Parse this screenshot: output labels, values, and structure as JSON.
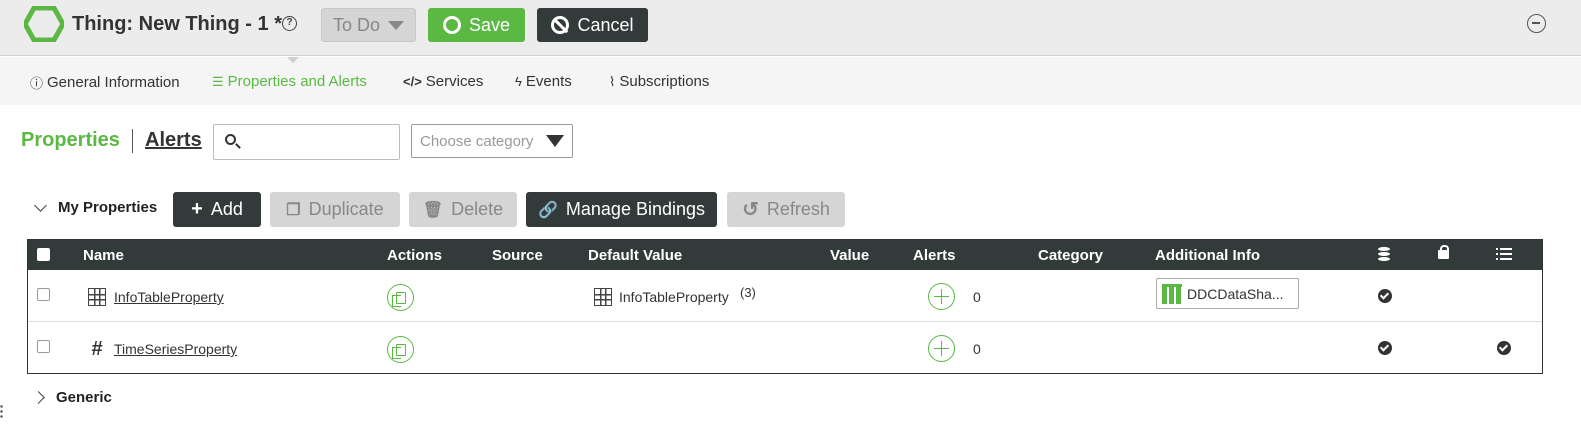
{
  "header": {
    "title": "Thing: New Thing - 1 *",
    "help_icon": "?",
    "status_select": "To Do",
    "save_label": "Save",
    "cancel_label": "Cancel",
    "brand_color": "#5bb943"
  },
  "tabs": [
    {
      "label": "General Information",
      "icon": "info-icon"
    },
    {
      "label": "Properties and Alerts",
      "icon": "list-icon",
      "active": true
    },
    {
      "label": "Services",
      "icon": "code-icon"
    },
    {
      "label": "Events",
      "icon": "bolt-icon"
    },
    {
      "label": "Subscriptions",
      "icon": "rss-icon"
    }
  ],
  "subtabs": {
    "properties": "Properties",
    "alerts": "Alerts"
  },
  "search": {
    "value": "",
    "placeholder": ""
  },
  "category_select": {
    "placeholder": "Choose category"
  },
  "group": {
    "label": "My Properties",
    "add": "Add",
    "duplicate": "Duplicate",
    "delete": "Delete",
    "manage_bindings": "Manage Bindings",
    "refresh": "Refresh"
  },
  "table": {
    "columns": [
      "Name",
      "Actions",
      "Source",
      "Default Value",
      "Value",
      "Alerts",
      "Category",
      "Additional Info"
    ],
    "rows": [
      {
        "type_icon": "infotable-icon",
        "name": "InfoTableProperty",
        "source": "",
        "default_value": "InfoTableProperty",
        "default_count": "(3)",
        "value": "",
        "alerts": "0",
        "category": "",
        "additional_info": "DDCDataSha...",
        "persistent": true,
        "read_only": false,
        "logged": false
      },
      {
        "type_icon": "hash-icon",
        "name": "TimeSeriesProperty",
        "source": "",
        "default_value": "",
        "value": "",
        "alerts": "0",
        "category": "",
        "additional_info": "",
        "persistent": true,
        "read_only": false,
        "logged": true
      }
    ]
  },
  "generic_group": {
    "label": "Generic"
  }
}
